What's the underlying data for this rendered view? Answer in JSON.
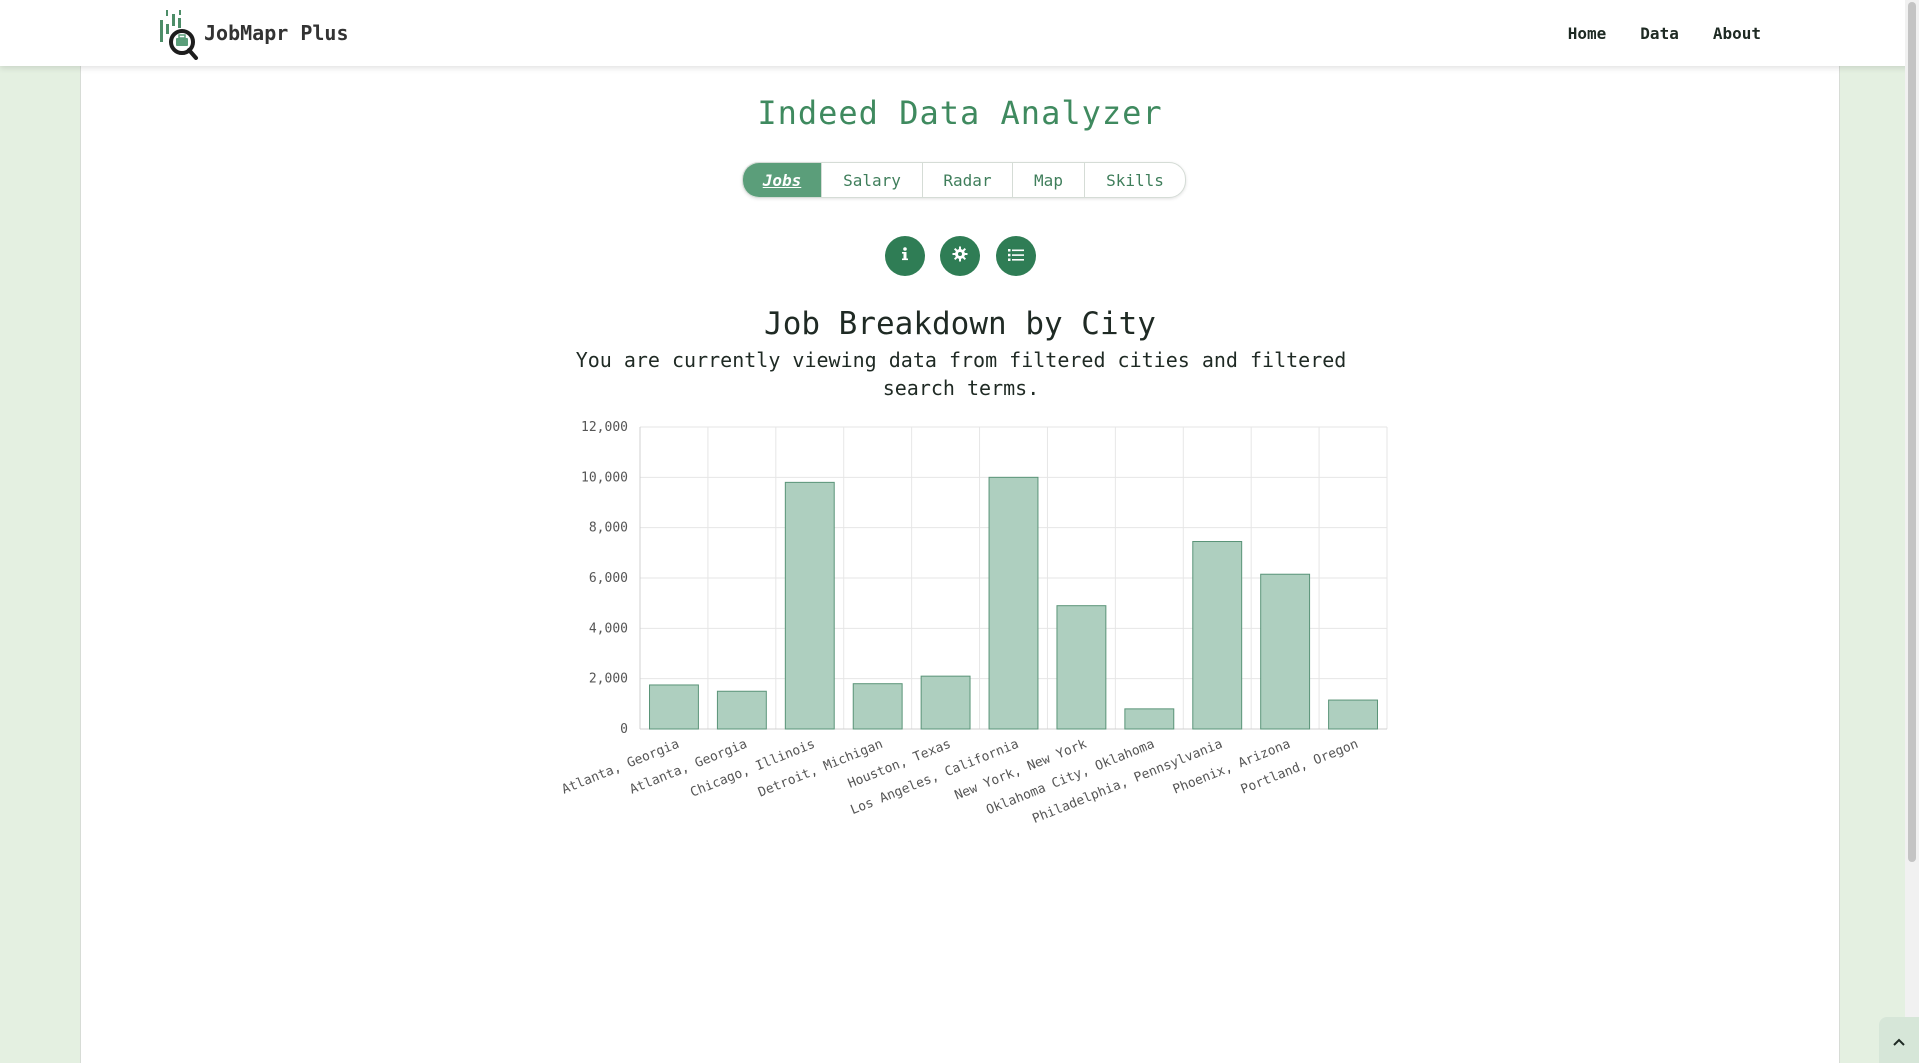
{
  "navbar": {
    "brand": "JobMapr Plus",
    "links": [
      "Home",
      "Data",
      "About"
    ]
  },
  "page": {
    "title": "Indeed Data Analyzer"
  },
  "tabs": [
    {
      "label": "Jobs",
      "active": true
    },
    {
      "label": "Salary",
      "active": false
    },
    {
      "label": "Radar",
      "active": false
    },
    {
      "label": "Map",
      "active": false
    },
    {
      "label": "Skills",
      "active": false
    }
  ],
  "actions": [
    {
      "icon": "info-icon"
    },
    {
      "icon": "gear-icon"
    },
    {
      "icon": "list-icon"
    }
  ],
  "chart": {
    "title": "Job Breakdown by City",
    "subtitle": "You are currently viewing data from filtered cities and filtered search terms."
  },
  "colors": {
    "accent": "#3f8a5f",
    "bar_fill": "#aecfbf",
    "bar_stroke": "#5a9478",
    "background": "#e4f0e1"
  },
  "chart_data": {
    "type": "bar",
    "categories": [
      "Atlanta,  Georgia",
      "Atlanta, Georgia",
      "Chicago, Illinois",
      "Detroit, Michigan",
      "Houston, Texas",
      "Los Angeles, California",
      "New York, New York",
      "Oklahoma City, Oklahoma",
      "Philadelphia, Pennsylvania",
      "Phoenix, Arizona",
      "Portland, Oregon"
    ],
    "values": [
      1750,
      1500,
      9800,
      1800,
      2100,
      10000,
      4900,
      800,
      7450,
      6150,
      1150
    ],
    "yticks": [
      "0",
      "2,000",
      "4,000",
      "6,000",
      "8,000",
      "10,000",
      "12,000"
    ],
    "ylim": [
      0,
      12000
    ],
    "grid": true
  }
}
